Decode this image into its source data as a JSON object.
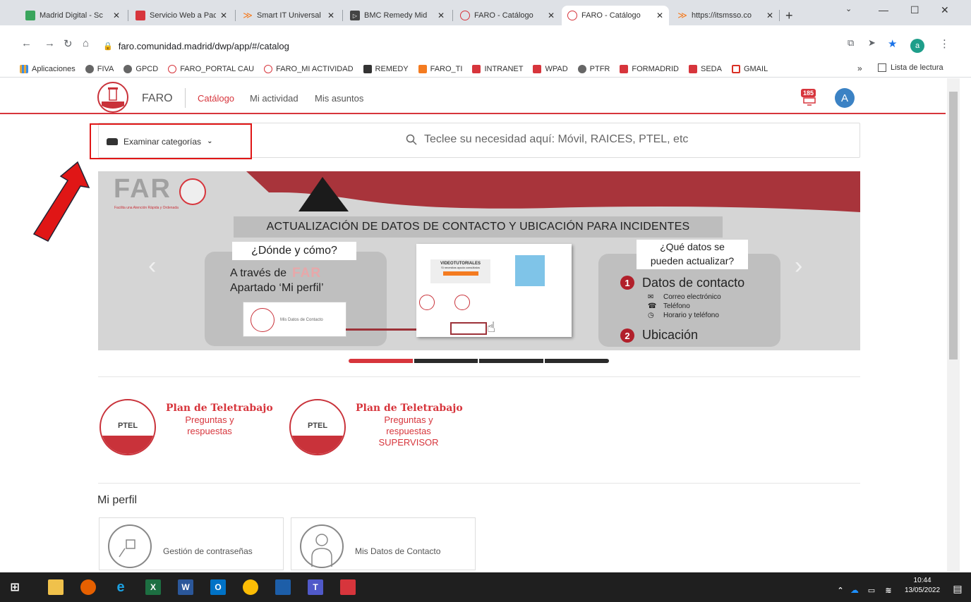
{
  "browser": {
    "tabs": [
      {
        "label": "Madrid Digital - Sc",
        "active": false
      },
      {
        "label": "Servicio Web a Pac",
        "active": false
      },
      {
        "label": "Smart IT Universal",
        "active": false
      },
      {
        "label": "BMC Remedy Mid",
        "active": false
      },
      {
        "label": "FARO - Catálogo",
        "active": false
      },
      {
        "label": "FARO - Catálogo",
        "active": true
      },
      {
        "label": "https://itsmsso.co",
        "active": false
      }
    ],
    "new_tab": "+",
    "close_glyph": "✕",
    "url": "faro.comunidad.madrid/dwp/app/#/catalog",
    "profile_initial": "a",
    "bookmarks": [
      {
        "label": "Aplicaciones",
        "color": "#e8a73a"
      },
      {
        "label": "FIVA",
        "color": "#666"
      },
      {
        "label": "GPCD",
        "color": "#666"
      },
      {
        "label": "FARO_PORTAL CAU",
        "color": "#d7353c"
      },
      {
        "label": "FARO_MI ACTIVIDAD",
        "color": "#d7353c"
      },
      {
        "label": "REMEDY",
        "color": "#333"
      },
      {
        "label": "FARO_TI",
        "color": "#f47b20"
      },
      {
        "label": "INTRANET",
        "color": "#d7353c"
      },
      {
        "label": "WPAD",
        "color": "#d7353c"
      },
      {
        "label": "PTFR",
        "color": "#666"
      },
      {
        "label": "FORMADRID",
        "color": "#d7353c"
      },
      {
        "label": "SEDA",
        "color": "#d7353c"
      },
      {
        "label": "GMAIL",
        "color": "#d93025"
      }
    ],
    "more_bookmarks": "»",
    "reading_list": "Lista de lectura"
  },
  "faro": {
    "brand": "FARO",
    "nav": [
      "Catálogo",
      "Mi actividad",
      "Mis asuntos"
    ],
    "notif_count": "185",
    "avatar_initial": "A",
    "browse_label": "Examinar categorías",
    "search_placeholder": "Teclee su necesidad aquí: Móvil, RAICES, PTEL, etc"
  },
  "banner": {
    "brand": "FAR",
    "tagline": "Facilita una Atención Rápida y Ordenada",
    "title": "ACTUALIZACIÓN DE DATOS DE CONTACTO Y UBICACIÓN PARA INCIDENTES",
    "q1": "¿Dónde y cómo?",
    "left_line1": "A través de",
    "left_brand": "FAR",
    "left_line2": "Apartado ‘Mi perfil’",
    "left_card": "Mis Datos de Contacto",
    "mock_title": "VIDEOTUTORIALES",
    "mock_sub": "Si necesitas ayuda consúltalos",
    "q2_line1": "¿Qué datos se",
    "q2_line2": "pueden actualizar?",
    "item1_num": "1",
    "item1": "Datos de contacto",
    "sub1": "Correo electrónico",
    "sub2": "Teléfono",
    "sub3": "Horario y teléfono",
    "item2_num": "2",
    "item2": "Ubicación",
    "prev": "‹",
    "next": "›",
    "active_slide": 1,
    "slide_count": 4
  },
  "ptel": [
    {
      "logo": "PTEL",
      "title": "Plan de Teletrabajo",
      "sub": [
        "Preguntas y",
        "respuestas"
      ]
    },
    {
      "logo": "PTEL",
      "title": "Plan de Teletrabajo",
      "sub": [
        "Preguntas y",
        "respuestas",
        "SUPERVISOR"
      ]
    }
  ],
  "profile": {
    "heading": "Mi perfil",
    "cards": [
      "Gestión de contraseñas",
      "Mis Datos de Contacto"
    ]
  },
  "taskbar": {
    "time": "10:44",
    "date": "13/05/2022"
  },
  "colors": {
    "brand_red": "#d7353c",
    "highlight_red": "#e01616"
  }
}
